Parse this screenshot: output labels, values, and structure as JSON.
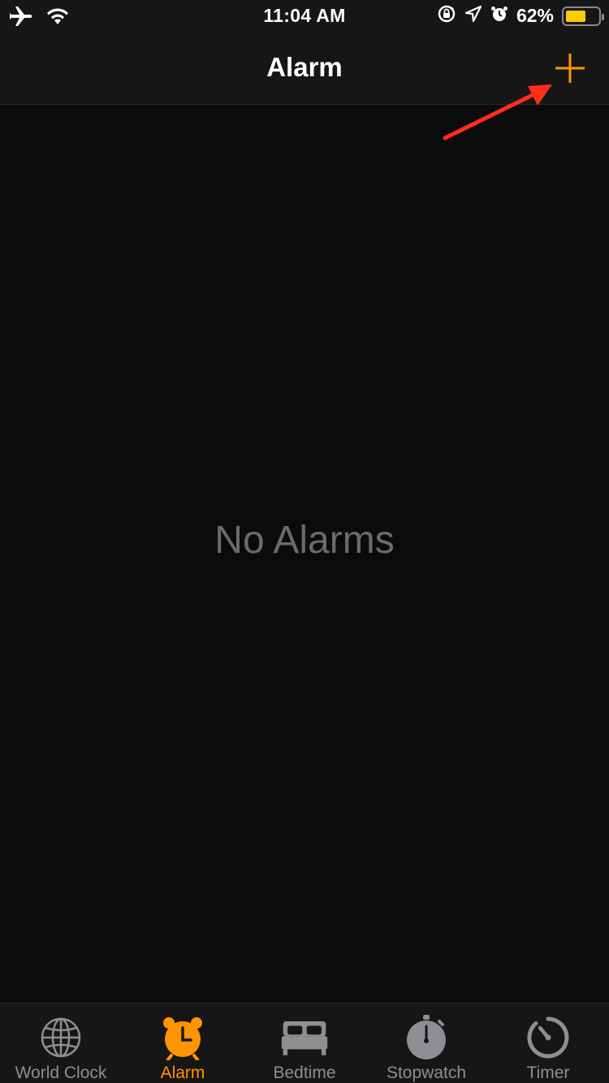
{
  "status_bar": {
    "time": "11:04 AM",
    "battery_percent": "62%",
    "battery_level": 0.62,
    "icons": [
      "airplane-icon",
      "wifi-icon",
      "rotation-lock-icon",
      "location-icon",
      "alarm-clock-icon",
      "battery-icon"
    ]
  },
  "nav": {
    "title": "Alarm",
    "add_icon": "plus-icon"
  },
  "content": {
    "empty_message": "No Alarms"
  },
  "tabs": [
    {
      "label": "World Clock",
      "icon": "globe-icon",
      "active": false
    },
    {
      "label": "Alarm",
      "icon": "alarm-clock-icon",
      "active": true
    },
    {
      "label": "Bedtime",
      "icon": "bed-icon",
      "active": false
    },
    {
      "label": "Stopwatch",
      "icon": "stopwatch-icon",
      "active": false
    },
    {
      "label": "Timer",
      "icon": "timer-icon",
      "active": false
    }
  ],
  "colors": {
    "accent": "#ff9500",
    "inactive": "#8e8e93",
    "annotation": "#ff2d1a",
    "battery_fill": "#ffcc00"
  }
}
